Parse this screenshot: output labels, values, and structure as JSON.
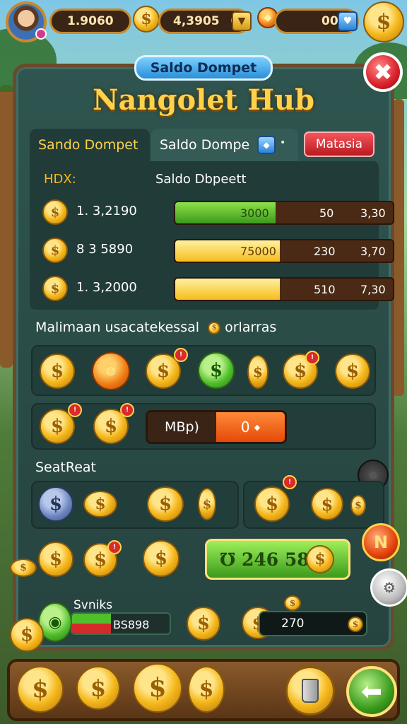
{
  "topbar": {
    "counter1": "1.9060",
    "counter2": "4,3905",
    "counter2_suffix": "0",
    "counter3": "00",
    "coin_symbol": "$"
  },
  "panel": {
    "header_tab": "Saldo Dompet",
    "title": "Nangolet Hub",
    "close_symbol": "✖"
  },
  "tabs": {
    "tab1": "Sando Dompet",
    "tab2": "Saldo Dompe",
    "tab3": "Matasia"
  },
  "table": {
    "col1": "HDX:",
    "col2": "Saldo Dbpeett",
    "rows": [
      {
        "qty": "1. 3,2190",
        "bar_left": "3000",
        "bar_mid": "50",
        "bar_right": "3,30",
        "fill": 0.44,
        "color": "green"
      },
      {
        "qty": "8 3 5890",
        "bar_left": "75000",
        "bar_mid": "230",
        "bar_right": "3,70",
        "fill": 0.48,
        "color": "gold"
      },
      {
        "qty": "1. 3,2000",
        "bar_left": "",
        "bar_mid": "510",
        "bar_right": "7,30",
        "fill": 0.48,
        "color": "gold"
      }
    ]
  },
  "section1": {
    "label": "Malimaan usacatekessal",
    "label2": "orlarras"
  },
  "counter": {
    "left": "MBp)",
    "right": "0"
  },
  "section2": {
    "label": "SeatReat"
  },
  "green_button": {
    "label": "℧ 246 58",
    "symbol": "$"
  },
  "footer": {
    "name": "Svniks",
    "mini_value": "BS898",
    "pill_value": "270"
  },
  "side": {
    "n_label": "N"
  },
  "colors": {
    "panel": "#2f5550",
    "accent_gold": "#ffd24a",
    "close_red": "#d8202a",
    "green": "#3b9a1c"
  }
}
